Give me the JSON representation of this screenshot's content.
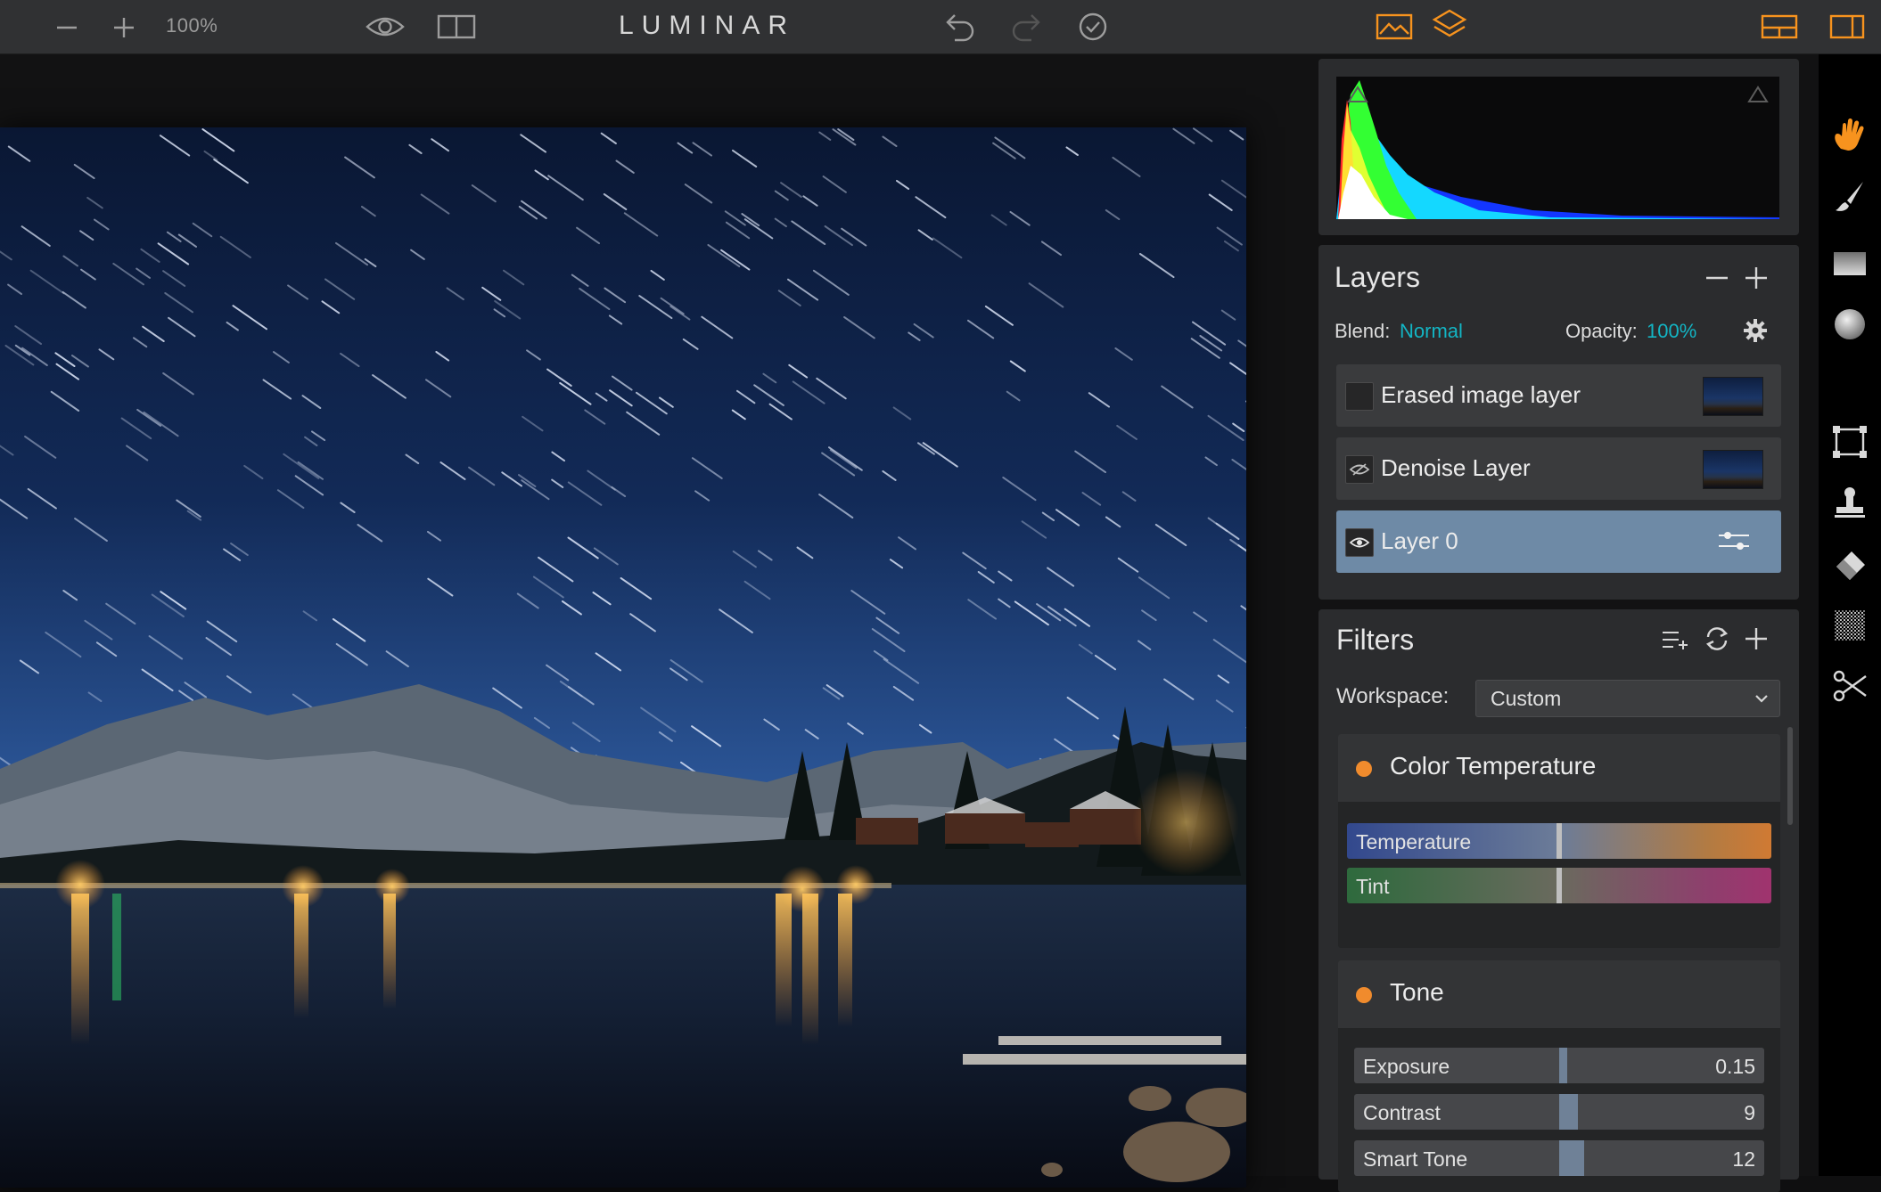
{
  "toolbar": {
    "zoom_value": "100%",
    "app_title": "LUMINAR"
  },
  "histogram": {
    "clip_low_icon": "shadow-clipping-triangle",
    "clip_high_icon": "highlight-clipping-triangle"
  },
  "layers": {
    "title": "Layers",
    "blend_label": "Blend:",
    "blend_value": "Normal",
    "opacity_label": "Opacity:",
    "opacity_value": "100%",
    "items": [
      {
        "name": "Erased image layer",
        "visibility": "hidden",
        "selected": false
      },
      {
        "name": "Denoise Layer",
        "visibility": "hidden",
        "selected": false
      },
      {
        "name": "Layer 0",
        "visibility": "visible",
        "selected": true
      }
    ]
  },
  "filters": {
    "title": "Filters",
    "workspace_label": "Workspace:",
    "workspace_value": "Custom",
    "blocks": [
      {
        "name": "Color Temperature",
        "sliders": [
          {
            "label": "Temperature",
            "value": 0
          },
          {
            "label": "Tint",
            "value": 0
          }
        ]
      },
      {
        "name": "Tone",
        "sliders": [
          {
            "label": "Exposure",
            "value": "0.15"
          },
          {
            "label": "Contrast",
            "value": "9"
          },
          {
            "label": "Smart Tone",
            "value": "12"
          }
        ]
      }
    ]
  },
  "colors": {
    "accent": "#f7931e",
    "teal": "#13b5c4",
    "selected_layer": "#6e8aa6",
    "filter_dot": "#f08b2d"
  },
  "tools": [
    "hand-icon",
    "brush-icon",
    "gradient-icon",
    "radial-icon",
    "crop-icon",
    "clone-stamp-icon",
    "eraser-icon",
    "noise-icon",
    "scissors-icon"
  ]
}
